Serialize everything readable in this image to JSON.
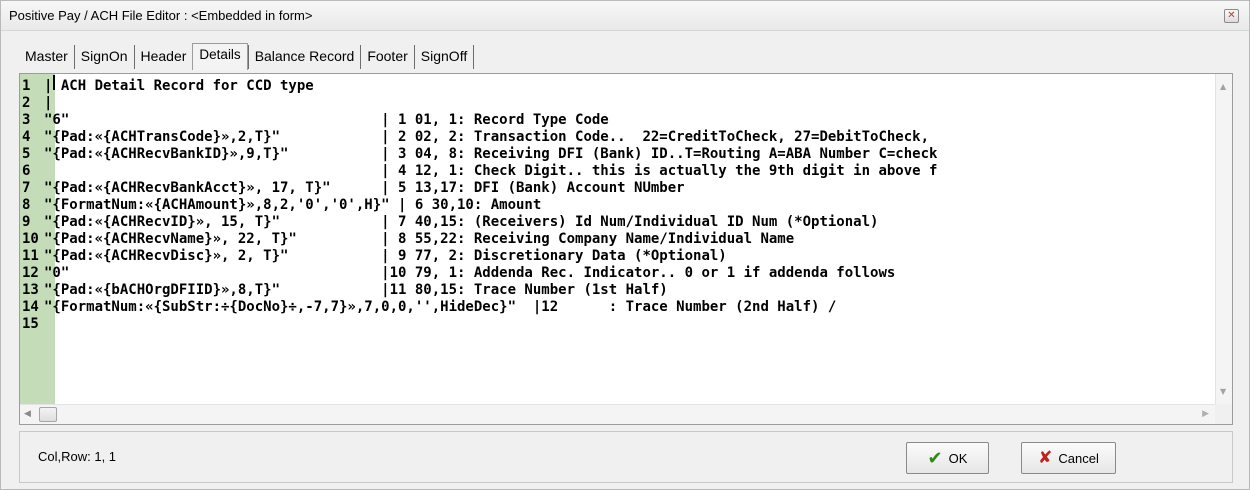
{
  "window": {
    "title": "Positive Pay / ACH File  Editor : <Embedded in form>",
    "close_glyph": "✕"
  },
  "tabs": [
    {
      "label": "Master"
    },
    {
      "label": "SignOn"
    },
    {
      "label": "Header"
    },
    {
      "label": "Details"
    },
    {
      "label": "Balance Record"
    },
    {
      "label": "Footer"
    },
    {
      "label": "SignOff"
    }
  ],
  "active_tab": "Details",
  "editor": {
    "lines": [
      {
        "num": "1",
        "text": "| ACH Detail Record for CCD type"
      },
      {
        "num": "2",
        "text": "|"
      },
      {
        "num": "3",
        "text": "\"6\"                                     | 1 01, 1: Record Type Code"
      },
      {
        "num": "4",
        "text": "\"{Pad:«{ACHTransCode}»,2,T}\"            | 2 02, 2: Transaction Code..  22=CreditToCheck, 27=DebitToCheck,"
      },
      {
        "num": "5",
        "text": "\"{Pad:«{ACHRecvBankID}»,9,T}\"           | 3 04, 8: Receiving DFI (Bank) ID..T=Routing A=ABA Number C=check"
      },
      {
        "num": "6",
        "text": "                                        | 4 12, 1: Check Digit.. this is actually the 9th digit in above f"
      },
      {
        "num": "7",
        "text": "\"{Pad:«{ACHRecvBankAcct}», 17, T}\"      | 5 13,17: DFI (Bank) Account NUmber"
      },
      {
        "num": "8",
        "text": "\"{FormatNum:«{ACHAmount}»,8,2,'0','0',H}\" | 6 30,10: Amount"
      },
      {
        "num": "9",
        "text": "\"{Pad:«{ACHRecvID}», 15, T}\"            | 7 40,15: (Receivers) Id Num/Individual ID Num (*Optional)"
      },
      {
        "num": "10",
        "text": "\"{Pad:«{ACHRecvName}», 22, T}\"          | 8 55,22: Receiving Company Name/Individual Name"
      },
      {
        "num": "11",
        "text": "\"{Pad:«{ACHRecvDisc}», 2, T}\"           | 9 77, 2: Discretionary Data (*Optional)"
      },
      {
        "num": "12",
        "text": "\"0\"                                     |10 79, 1: Addenda Rec. Indicator.. 0 or 1 if addenda follows"
      },
      {
        "num": "13",
        "text": "\"{Pad:«{bACHOrgDFIID}»,8,T}\"            |11 80,15: Trace Number (1st Half)"
      },
      {
        "num": "14",
        "text": "\"{FormatNum:«{SubStr:÷{DocNo}÷,-7,7}»,7,0,0,'',HideDec}\"  |12      : Trace Number (2nd Half) /"
      },
      {
        "num": "15",
        "text": ""
      }
    ],
    "gutter_color": "#c4ddb8"
  },
  "status": {
    "colrow": "Col,Row: 1, 1"
  },
  "buttons": {
    "ok_label": "OK",
    "cancel_label": "Cancel",
    "ok_icon": "✔",
    "cancel_icon": "✘"
  }
}
